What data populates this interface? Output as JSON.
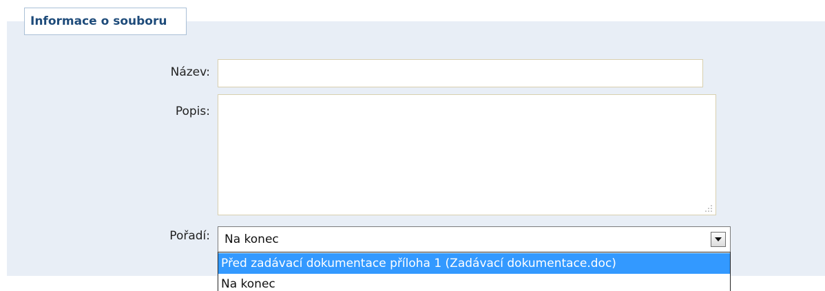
{
  "section": {
    "legend": "Informace o souboru"
  },
  "fields": {
    "nazev_label": "Název:",
    "nazev_value": "",
    "popis_label": "Popis:",
    "popis_value": "",
    "poradi_label": "Pořadí:",
    "poradi_selected": "Na konec"
  },
  "dropdown": {
    "options": [
      {
        "label": "Před zadávací dokumentace příloha 1 (Zadávací dokumentace.doc)",
        "highlighted": true
      },
      {
        "label": "Na konec",
        "highlighted": false
      }
    ]
  },
  "colors": {
    "panel_bg": "#e8eef6",
    "legend_text": "#1e4b7a",
    "legend_border": "#a9bfd6",
    "input_border": "#d8cfae",
    "highlight": "#3399ff"
  },
  "icons": {
    "select_arrow": "chevron-down-icon",
    "textarea_grip": "resize-grip-icon"
  }
}
